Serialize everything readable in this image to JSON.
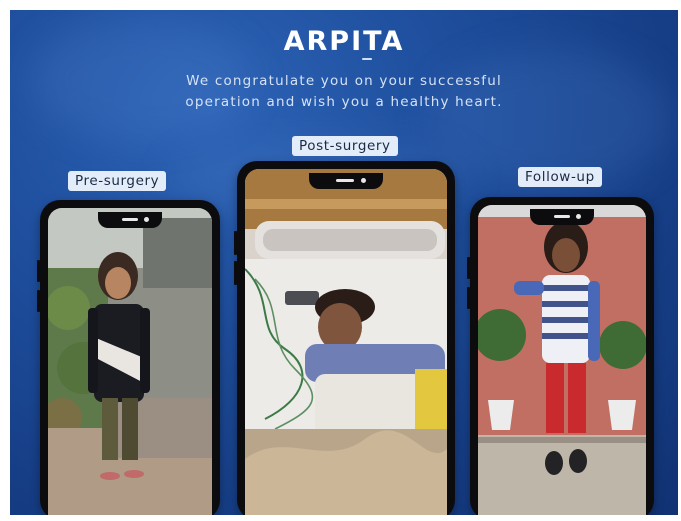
{
  "header": {
    "title": "ARPITA",
    "subtitle_line1": "We congratulate you on your successful",
    "subtitle_line2": "operation and wish you a healthy heart."
  },
  "phones": [
    {
      "label": "Pre-surgery",
      "photo": "girl-standing-outdoors"
    },
    {
      "label": "Post-surgery",
      "photo": "girl-in-hospital-bed"
    },
    {
      "label": "Follow-up",
      "photo": "girl-standing-indoors"
    }
  ],
  "colors": {
    "background": "#1a4791",
    "label_bg": "#e3edf9",
    "phone_frame": "#0c0c0e"
  }
}
